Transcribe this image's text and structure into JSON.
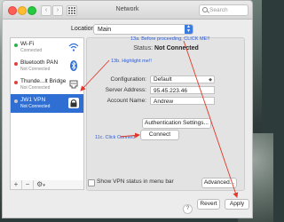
{
  "window": {
    "title": "Network"
  },
  "search": {
    "placeholder": "Search"
  },
  "location": {
    "label": "Location:",
    "value": "Main"
  },
  "services": [
    {
      "name": "Wi-Fi",
      "status": "Connected",
      "dot": "#2bb24c",
      "icon": "wifi-icon"
    },
    {
      "name": "Bluetooth PAN",
      "status": "Not Connected",
      "dot": "#e0413a",
      "icon": "bluetooth-icon"
    },
    {
      "name": "Thunde...lt Bridge",
      "status": "Not Connected",
      "dot": "#e0413a",
      "icon": "ethernet-icon"
    },
    {
      "name": "JW1 VPN",
      "status": "Not Connected",
      "dot": "#c9c9c9",
      "icon": "lock-icon"
    }
  ],
  "sidebar_controls": {
    "add": "+",
    "remove": "−",
    "gear": "⚙"
  },
  "detail": {
    "status_label": "Status:",
    "status_value": "Not Connected",
    "configuration_label": "Configuration:",
    "configuration_value": "Default",
    "server_label": "Server Address:",
    "server_value": "95.45.223.46",
    "account_label": "Account Name:",
    "account_value": "Andrew",
    "auth_button": "Authentication Settings...",
    "connect_button": "Connect",
    "show_vpn_label": "Show VPN status in menu bar",
    "advanced_button": "Advanced...",
    "help": "?"
  },
  "footer": {
    "revert": "Revert",
    "apply": "Apply"
  },
  "annotations": {
    "a": "13a. Before proceeding, CLICK ME!!",
    "b": "13b. Highlight me!!",
    "c": "11c. Click Connect"
  },
  "colors": {
    "annotation": "#2a5bd7",
    "arrow": "#e0392b",
    "selection": "#2f6ed3"
  }
}
